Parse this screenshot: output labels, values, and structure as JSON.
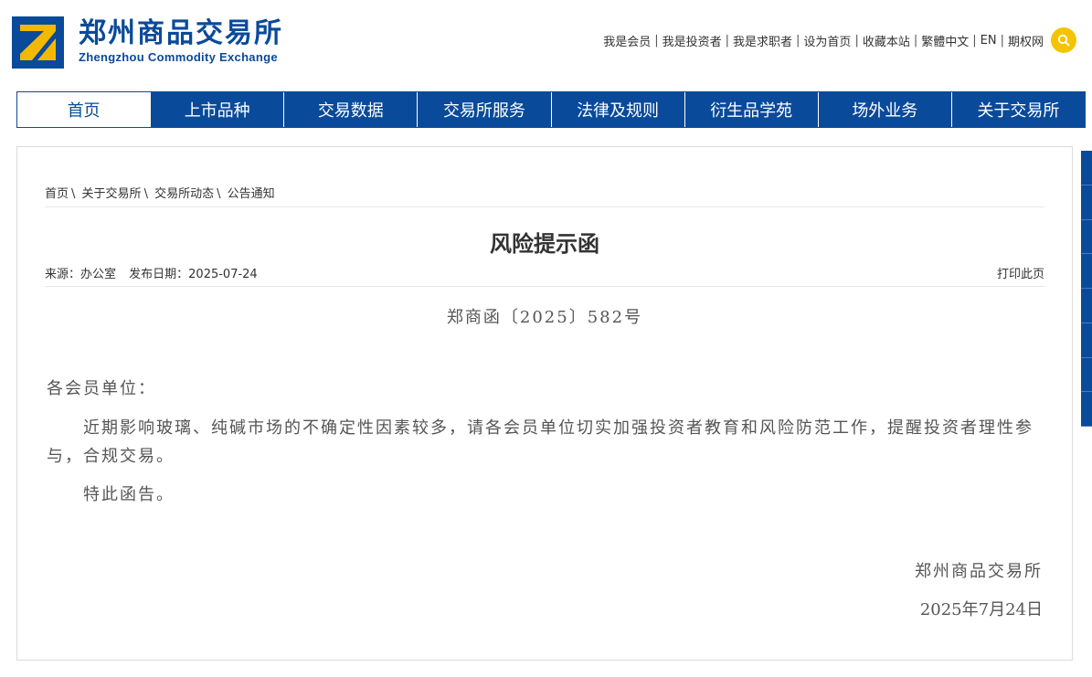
{
  "header": {
    "logo_cn": "郑州商品交易所",
    "logo_en": "Zhengzhou Commodity Exchange",
    "links": [
      "我是会员",
      "我是投资者",
      "我是求职者",
      "设为首页",
      "收藏本站",
      "繁體中文",
      "EN",
      "期权网"
    ],
    "search_icon": "search-icon",
    "accent_color": "#0a4a9a",
    "search_color": "#f5c400"
  },
  "nav": {
    "items": [
      "首页",
      "上市品种",
      "交易数据",
      "交易所服务",
      "法律及规则",
      "衍生品学苑",
      "场外业务",
      "关于交易所"
    ],
    "active_index": 0
  },
  "breadcrumb": [
    "首页",
    "关于交易所",
    "交易所动态",
    "公告通知"
  ],
  "article": {
    "title": "风险提示函",
    "source": "来源：办公室",
    "date": "发布日期：2025-07-24",
    "print_label": "打印此页",
    "doc_number": "郑商函〔2025〕582号",
    "salutation": "各会员单位：",
    "paragraph1": "近期影响玻璃、纯碱市场的不确定性因素较多，请各会员单位切实加强投资者教育和风险防范工作，提醒投资者理性参与，合规交易。",
    "paragraph2": "特此函告。",
    "signer": "郑州商品交易所",
    "sign_date": "2025年7月24日"
  }
}
